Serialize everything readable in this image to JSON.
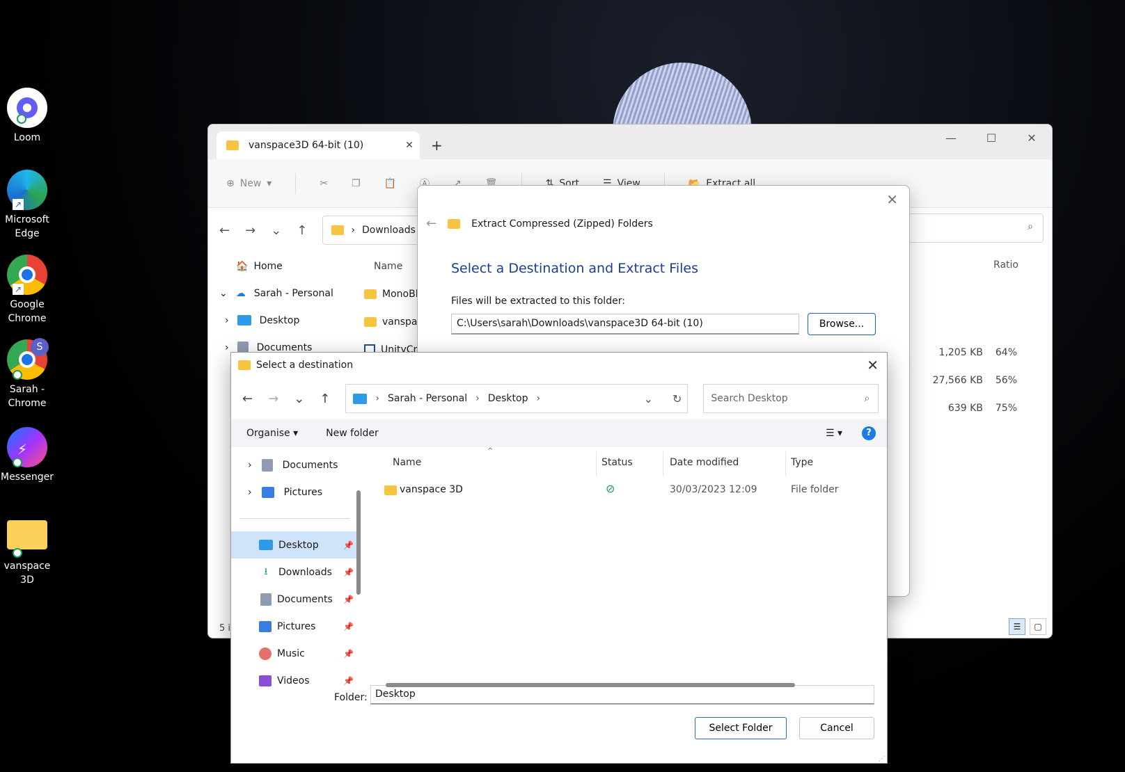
{
  "desktop": {
    "icons": [
      {
        "label": "Loom"
      },
      {
        "label1": "Microsoft",
        "label2": "Edge"
      },
      {
        "label1": "Google",
        "label2": "Chrome"
      },
      {
        "label1": "Sarah -",
        "label2": "Chrome",
        "badge": "S"
      },
      {
        "label": "Messenger"
      },
      {
        "label": "vanspace 3D"
      }
    ]
  },
  "explorer": {
    "tab_title": "vanspace3D 64-bit (10)",
    "toolbar": {
      "new": "New",
      "sort": "Sort",
      "view": "View",
      "extract_all": "Extract all",
      "more": "..."
    },
    "address": "Downloads",
    "nav": [
      "Home",
      "Sarah - Personal",
      "Desktop",
      "Documents"
    ],
    "columns": {
      "name": "Name",
      "ratio": "Ratio"
    },
    "files": [
      {
        "name": "MonoBl",
        "size": "1,205 KB",
        "ratio": "64%"
      },
      {
        "name": "vanspace",
        "size": "27,566 KB",
        "ratio": "56%"
      },
      {
        "name": "UnityCra",
        "size": "639 KB",
        "ratio": "75%"
      }
    ],
    "status": "5 i"
  },
  "extract_dialog": {
    "header": "Extract Compressed (Zipped) Folders",
    "heading": "Select a Destination and Extract Files",
    "label": "Files will be extracted to this folder:",
    "path": "C:\\Users\\sarah\\Downloads\\vanspace3D 64-bit (10)",
    "browse": "Browse..."
  },
  "dest_dialog": {
    "title": "Select a destination",
    "breadcrumbs": [
      "Sarah - Personal",
      "Desktop"
    ],
    "search_placeholder": "Search Desktop",
    "organise": "Organise",
    "new_folder": "New folder",
    "nav": [
      {
        "label": "Documents",
        "type": "tree"
      },
      {
        "label": "Pictures",
        "type": "tree"
      },
      {
        "label": "Desktop",
        "type": "quick",
        "selected": true
      },
      {
        "label": "Downloads",
        "type": "quick"
      },
      {
        "label": "Documents",
        "type": "quick"
      },
      {
        "label": "Pictures",
        "type": "quick"
      },
      {
        "label": "Music",
        "type": "quick"
      },
      {
        "label": "Videos",
        "type": "quick"
      }
    ],
    "columns": {
      "name": "Name",
      "status": "Status",
      "date": "Date modified",
      "type": "Type"
    },
    "rows": [
      {
        "name": "vanspace 3D",
        "date": "30/03/2023 12:09",
        "type": "File folder"
      }
    ],
    "folder_label": "Folder:",
    "folder_value": "Desktop",
    "select_btn": "Select Folder",
    "cancel_btn": "Cancel"
  },
  "colors": {
    "accent": "#1a3e96",
    "folder": "#f5c542",
    "primary_border": "#2a6bd0"
  }
}
